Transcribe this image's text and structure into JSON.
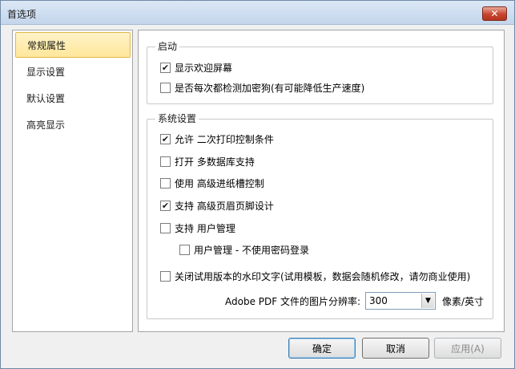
{
  "window": {
    "title": "首选项",
    "close_glyph": "✕"
  },
  "sidebar": {
    "items": [
      {
        "label": "常规属性",
        "active": true
      },
      {
        "label": "显示设置",
        "active": false
      },
      {
        "label": "默认设置",
        "active": false
      },
      {
        "label": "高亮显示",
        "active": false
      }
    ]
  },
  "startup": {
    "legend": "启动",
    "options": [
      {
        "label": "显示欢迎屏幕",
        "checked": true
      },
      {
        "label": "是否每次都检测加密狗(有可能降低生产速度)",
        "checked": false
      }
    ]
  },
  "system": {
    "legend": "系统设置",
    "options": [
      {
        "label": "允许 二次打印控制条件",
        "checked": true
      },
      {
        "label": "打开 多数据库支持",
        "checked": false
      },
      {
        "label": "使用 高级进纸槽控制",
        "checked": false
      },
      {
        "label": "支持 高级页眉页脚设计",
        "checked": true
      },
      {
        "label": "支持 用户管理",
        "checked": false
      },
      {
        "label": "用户管理 - 不使用密码登录",
        "checked": false
      },
      {
        "label": "关闭试用版本的水印文字(试用模板，数据会随机修改，请勿商业使用)",
        "checked": false
      }
    ],
    "resolution": {
      "label": "Adobe PDF 文件的图片分辨率:",
      "value": "300",
      "unit": "像素/英寸"
    }
  },
  "buttons": {
    "ok": "确定",
    "cancel": "取消",
    "apply": "应用(A)"
  },
  "icons": {
    "checkbox_checked": "✔",
    "dropdown": "▼"
  }
}
